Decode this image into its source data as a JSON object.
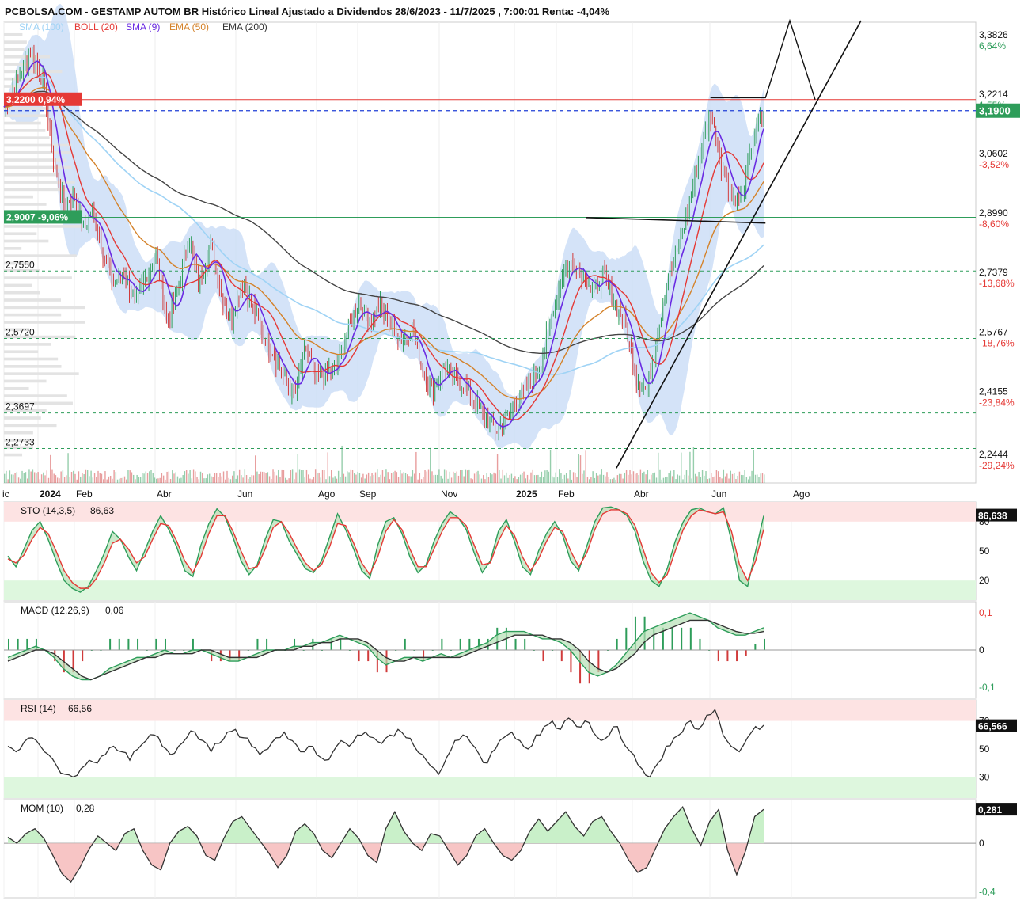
{
  "header": {
    "title": "PCBOLSA.COM - GESTAMP AUTOM BR Histórico Lineal Ajustado a Dividendos 28/6/2023 - 11/7/2025 , 7:00:01 Renta: -4,04%",
    "legend": [
      {
        "text": "SMA (100)",
        "color": "#9fd3f5"
      },
      {
        "text": "BOLL (20)",
        "color": "#e53935"
      },
      {
        "text": "SMA (9)",
        "color": "#6a2be2"
      },
      {
        "text": "EMA (50)",
        "color": "#d4822a"
      },
      {
        "text": "EMA (200)",
        "color": "#333333"
      }
    ]
  },
  "colors": {
    "bull": "#2e9d5a",
    "bear": "#d13b3b",
    "boll_fill": "#c9dcf6",
    "sma100": "#9fd3f5",
    "sma9": "#6a2be2",
    "boll_mid": "#e53935",
    "ema50": "#d4822a",
    "ema200": "#444444",
    "support_green": "#2e9d5a",
    "resistance_red": "#e53935",
    "current_blue": "#1f3fd6",
    "overbought_zone": "#fde3e3",
    "oversold_zone": "#def7de"
  },
  "chart_data": [
    {
      "type": "candlestick",
      "title": "GESTAMP AUTOM BR",
      "x_ticks": [
        "ic",
        "2024",
        "Feb",
        "Abr",
        "Jun",
        "Ago",
        "Sep",
        "Nov",
        "2025",
        "Feb",
        "Abr",
        "Jun",
        "Ago"
      ],
      "y_ticks": [
        "3,3826",
        "3,2214",
        "3,0602",
        "2,8990",
        "2,7379",
        "2,5767",
        "2,4155",
        "2,2444"
      ],
      "y_range": [
        2.18,
        3.43
      ],
      "right_percent_labels": [
        {
          "text": "6,64%",
          "value": 3.3826,
          "color": "#2e9d5a"
        },
        {
          "text": "1,55%",
          "value": 3.2214,
          "color": "#2e9d5a"
        },
        {
          "text": "-3,52%",
          "value": 3.0602,
          "color": "#e53935"
        },
        {
          "text": "-8,60%",
          "value": 2.899,
          "color": "#e53935"
        },
        {
          "text": "-13,68%",
          "value": 2.7379,
          "color": "#e53935"
        },
        {
          "text": "-18,76%",
          "value": 2.5767,
          "color": "#e53935"
        },
        {
          "text": "-23,84%",
          "value": 2.4155,
          "color": "#e53935"
        },
        {
          "text": "-29,24%",
          "value": 2.2444,
          "color": "#e53935"
        }
      ],
      "last_price": {
        "text": "3,1900",
        "value": 3.19
      },
      "left_levels": [
        {
          "text": "3,2200  0,94%",
          "value": 3.22,
          "kind": "resistance"
        },
        {
          "text": "2,9007  -9,06%",
          "value": 2.9007,
          "kind": "support"
        },
        {
          "text": "2,7550",
          "value": 2.755,
          "kind": "dashed"
        },
        {
          "text": "2,5720",
          "value": 2.572,
          "kind": "dashed"
        },
        {
          "text": "2,3697",
          "value": 2.3697,
          "kind": "dashed"
        },
        {
          "text": "2,2733",
          "value": 2.2733,
          "kind": "dashed"
        }
      ],
      "close_path": [
        [
          0,
          3.2
        ],
        [
          8,
          3.28
        ],
        [
          15,
          3.35
        ],
        [
          22,
          3.27
        ],
        [
          28,
          3.05
        ],
        [
          34,
          2.93
        ],
        [
          40,
          2.97
        ],
        [
          45,
          2.87
        ],
        [
          50,
          2.92
        ],
        [
          56,
          2.8
        ],
        [
          62,
          2.72
        ],
        [
          68,
          2.75
        ],
        [
          74,
          2.66
        ],
        [
          80,
          2.74
        ],
        [
          86,
          2.79
        ],
        [
          92,
          2.62
        ],
        [
          98,
          2.7
        ],
        [
          104,
          2.85
        ],
        [
          110,
          2.72
        ],
        [
          116,
          2.83
        ],
        [
          122,
          2.7
        ],
        [
          128,
          2.62
        ],
        [
          134,
          2.73
        ],
        [
          140,
          2.66
        ],
        [
          146,
          2.58
        ],
        [
          152,
          2.53
        ],
        [
          158,
          2.46
        ],
        [
          164,
          2.42
        ],
        [
          170,
          2.55
        ],
        [
          176,
          2.46
        ],
        [
          182,
          2.48
        ],
        [
          188,
          2.5
        ],
        [
          194,
          2.6
        ],
        [
          200,
          2.67
        ],
        [
          206,
          2.62
        ],
        [
          212,
          2.66
        ],
        [
          218,
          2.61
        ],
        [
          224,
          2.57
        ],
        [
          230,
          2.6
        ],
        [
          236,
          2.48
        ],
        [
          242,
          2.43
        ],
        [
          248,
          2.5
        ],
        [
          254,
          2.46
        ],
        [
          260,
          2.44
        ],
        [
          266,
          2.39
        ],
        [
          272,
          2.35
        ],
        [
          278,
          2.32
        ],
        [
          284,
          2.36
        ],
        [
          290,
          2.41
        ],
        [
          296,
          2.44
        ],
        [
          302,
          2.5
        ],
        [
          308,
          2.62
        ],
        [
          314,
          2.74
        ],
        [
          320,
          2.78
        ],
        [
          326,
          2.75
        ],
        [
          332,
          2.7
        ],
        [
          338,
          2.74
        ],
        [
          344,
          2.67
        ],
        [
          350,
          2.61
        ],
        [
          356,
          2.47
        ],
        [
          362,
          2.43
        ],
        [
          368,
          2.58
        ],
        [
          374,
          2.74
        ],
        [
          380,
          2.82
        ],
        [
          386,
          2.93
        ],
        [
          392,
          3.07
        ],
        [
          398,
          3.18
        ],
        [
          404,
          3.05
        ],
        [
          410,
          2.96
        ],
        [
          416,
          2.95
        ],
        [
          422,
          3.12
        ],
        [
          428,
          3.19
        ]
      ],
      "chart_range_x": [
        0,
        428
      ]
    },
    {
      "type": "line",
      "title": "STO (14,3,5)",
      "value_label": "86,63",
      "last_value": "86,638",
      "y_ticks": [
        "80",
        "50",
        "20"
      ],
      "y_range": [
        0,
        100
      ],
      "zones": {
        "upper": 80,
        "lower": 20
      },
      "series": [
        {
          "name": "%K",
          "color": "#2e9d5a",
          "values": [
            45,
            34,
            52,
            71,
            80,
            62,
            40,
            20,
            12,
            8,
            14,
            30,
            48,
            70,
            62,
            44,
            30,
            50,
            70,
            86,
            72,
            54,
            30,
            24,
            56,
            78,
            93,
            85,
            64,
            40,
            26,
            36,
            62,
            82,
            80,
            60,
            46,
            32,
            28,
            40,
            64,
            88,
            72,
            52,
            30,
            22,
            56,
            80,
            84,
            68,
            44,
            28,
            36,
            60,
            78,
            90,
            84,
            72,
            48,
            28,
            40,
            70,
            82,
            60,
            34,
            26,
            50,
            68,
            80,
            66,
            40,
            30,
            55,
            80,
            94,
            95,
            92,
            86,
            70,
            40,
            20,
            14,
            32,
            60,
            80,
            92,
            94,
            90,
            88,
            94,
            60,
            20,
            14,
            50,
            86
          ]
        },
        {
          "name": "%D",
          "color": "#e53935",
          "values": [
            42,
            38,
            46,
            62,
            74,
            68,
            50,
            30,
            18,
            12,
            12,
            22,
            38,
            58,
            62,
            52,
            38,
            44,
            62,
            78,
            76,
            60,
            40,
            28,
            44,
            68,
            86,
            86,
            70,
            50,
            32,
            34,
            52,
            74,
            80,
            68,
            52,
            38,
            30,
            36,
            54,
            78,
            76,
            58,
            38,
            26,
            44,
            70,
            82,
            72,
            52,
            34,
            34,
            52,
            70,
            84,
            84,
            76,
            56,
            36,
            38,
            60,
            76,
            66,
            44,
            30,
            42,
            60,
            74,
            70,
            50,
            34,
            48,
            72,
            88,
            92,
            92,
            88,
            76,
            52,
            28,
            18,
            26,
            50,
            72,
            86,
            92,
            90,
            88,
            90,
            70,
            36,
            20,
            40,
            72
          ]
        }
      ]
    },
    {
      "type": "area",
      "title": "MACD (12,26,9)",
      "value_label": "0,06",
      "y_ticks": [
        "0,1",
        "0",
        "-0,1"
      ],
      "y_range": [
        -0.13,
        0.13
      ],
      "series": [
        {
          "name": "MACD",
          "color": "#2e9d5a",
          "values": [
            -0.02,
            -0.01,
            0.0,
            0.01,
            0.0,
            -0.02,
            -0.05,
            -0.07,
            -0.08,
            -0.08,
            -0.07,
            -0.05,
            -0.04,
            -0.03,
            -0.02,
            -0.02,
            -0.01,
            0.0,
            -0.01,
            -0.01,
            0.0,
            0.0,
            -0.01,
            -0.02,
            -0.03,
            -0.03,
            -0.02,
            -0.01,
            0.0,
            0.0,
            0.0,
            0.01,
            0.01,
            0.02,
            0.02,
            0.03,
            0.04,
            0.03,
            0.02,
            0.01,
            -0.02,
            -0.04,
            -0.03,
            -0.02,
            -0.02,
            -0.03,
            -0.02,
            -0.01,
            -0.02,
            -0.01,
            0.0,
            0.01,
            0.02,
            0.04,
            0.05,
            0.05,
            0.05,
            0.04,
            0.03,
            0.03,
            0.02,
            0.0,
            -0.03,
            -0.06,
            -0.07,
            -0.06,
            -0.04,
            -0.01,
            0.02,
            0.05,
            0.06,
            0.07,
            0.08,
            0.09,
            0.1,
            0.09,
            0.08,
            0.06,
            0.05,
            0.04,
            0.04,
            0.05,
            0.06
          ]
        },
        {
          "name": "Signal",
          "color": "#333333",
          "values": [
            -0.03,
            -0.02,
            -0.01,
            0.0,
            0.0,
            -0.01,
            -0.03,
            -0.05,
            -0.07,
            -0.08,
            -0.07,
            -0.06,
            -0.05,
            -0.04,
            -0.03,
            -0.02,
            -0.02,
            -0.01,
            -0.01,
            -0.01,
            -0.01,
            0.0,
            0.0,
            -0.01,
            -0.02,
            -0.02,
            -0.02,
            -0.02,
            -0.01,
            0.0,
            0.0,
            0.0,
            0.01,
            0.01,
            0.02,
            0.02,
            0.03,
            0.03,
            0.03,
            0.02,
            0.0,
            -0.02,
            -0.03,
            -0.03,
            -0.02,
            -0.02,
            -0.02,
            -0.02,
            -0.02,
            -0.02,
            -0.01,
            0.0,
            0.01,
            0.02,
            0.03,
            0.04,
            0.04,
            0.04,
            0.04,
            0.03,
            0.03,
            0.02,
            0.0,
            -0.03,
            -0.05,
            -0.06,
            -0.05,
            -0.03,
            -0.01,
            0.02,
            0.04,
            0.05,
            0.06,
            0.07,
            0.08,
            0.08,
            0.08,
            0.07,
            0.06,
            0.05,
            0.045,
            0.045,
            0.05
          ]
        }
      ]
    },
    {
      "type": "line",
      "title": "RSI (14)",
      "value_label": "66,56",
      "last_value": "66,566",
      "y_ticks": [
        "70",
        "50",
        "30"
      ],
      "y_range": [
        15,
        85
      ],
      "zones": {
        "upper": 70,
        "lower": 30
      },
      "series": [
        {
          "name": "RSI",
          "color": "#333333",
          "values": [
            52,
            48,
            55,
            58,
            52,
            46,
            38,
            32,
            30,
            36,
            42,
            40,
            46,
            52,
            48,
            42,
            50,
            56,
            60,
            52,
            46,
            52,
            58,
            62,
            56,
            48,
            54,
            62,
            64,
            58,
            52,
            46,
            50,
            58,
            62,
            56,
            48,
            52,
            46,
            42,
            48,
            56,
            52,
            60,
            62,
            58,
            54,
            60,
            64,
            58,
            52,
            46,
            38,
            32,
            44,
            56,
            60,
            54,
            46,
            40,
            50,
            58,
            62,
            56,
            50,
            60,
            66,
            70,
            64,
            72,
            66,
            70,
            62,
            56,
            60,
            66,
            52,
            46,
            36,
            30,
            40,
            52,
            58,
            62,
            70,
            64,
            74,
            78,
            60,
            52,
            48,
            58,
            66,
            67
          ]
        }
      ]
    },
    {
      "type": "area",
      "title": "MOM (10)",
      "value_label": "0,28",
      "last_value": "0,281",
      "y_ticks": [
        "0,3",
        "0",
        "-0,4"
      ],
      "y_range": [
        -0.45,
        0.36
      ],
      "series": [
        {
          "name": "MOM",
          "color": "#333333",
          "values": [
            0.05,
            0.0,
            0.08,
            0.12,
            0.04,
            -0.1,
            -0.25,
            -0.32,
            -0.2,
            -0.05,
            0.06,
            0.0,
            -0.06,
            0.08,
            0.12,
            -0.06,
            -0.18,
            -0.22,
            0.0,
            0.1,
            0.14,
            0.06,
            -0.1,
            -0.14,
            0.04,
            0.18,
            0.22,
            0.12,
            0.02,
            -0.08,
            -0.2,
            -0.1,
            0.1,
            0.16,
            0.08,
            -0.06,
            -0.12,
            0.0,
            0.12,
            0.04,
            -0.1,
            -0.16,
            0.12,
            0.26,
            0.1,
            0.0,
            -0.06,
            0.08,
            0.06,
            -0.06,
            -0.18,
            -0.1,
            0.06,
            0.12,
            0.0,
            -0.1,
            -0.14,
            -0.06,
            0.1,
            0.2,
            0.1,
            0.18,
            0.26,
            0.14,
            0.06,
            0.18,
            0.22,
            0.1,
            0.0,
            -0.14,
            -0.24,
            -0.2,
            -0.04,
            0.12,
            0.22,
            0.3,
            0.12,
            -0.02,
            0.18,
            0.28,
            -0.06,
            -0.26,
            -0.06,
            0.22,
            0.28
          ]
        }
      ]
    }
  ]
}
